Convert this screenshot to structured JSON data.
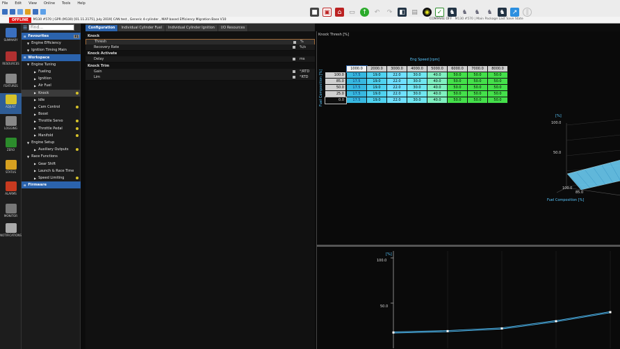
{
  "menu": [
    "File",
    "Edit",
    "View",
    "Online",
    "Tools",
    "Help"
  ],
  "status": {
    "offline_label": "OFFLINE",
    "ecu_info": "M130 #570 | GPR (M130) [01.11.2175], July 2019] CAN test , Generic 4-cylinder , MAP based Efficiency Migration Base V10",
    "compare_label": "COMPARE OFF",
    "compare_info": "M130 #570 | Main Package Last Save State"
  },
  "rail": [
    {
      "label": "SUMMARY",
      "icon": "summary-icon"
    },
    {
      "label": "RESOURCES",
      "icon": "resources-icon"
    },
    {
      "label": "FEATURES",
      "icon": "features-icon"
    },
    {
      "label": "ADJUST",
      "icon": "adjust-icon"
    },
    {
      "label": "LOGGING",
      "icon": "logging-icon"
    },
    {
      "label": "ZERO",
      "icon": "zero-icon"
    },
    {
      "label": "STATUS",
      "icon": "status-icon"
    },
    {
      "label": "ALARMS",
      "icon": "alarms-icon"
    },
    {
      "label": "MONITOR",
      "icon": "monitor-icon"
    },
    {
      "label": "NOTIFICATIONS",
      "icon": "notifications-icon"
    }
  ],
  "tree": {
    "search_placeholder": "Find...",
    "f1_badge": "F1",
    "rows": [
      {
        "label": "Favourites",
        "type": "section"
      },
      {
        "label": "Engine Efficiency",
        "indent": 1
      },
      {
        "label": "Ignition Timing Main",
        "indent": 1
      },
      {
        "label": "Workspace",
        "type": "section"
      },
      {
        "label": "Engine Tuning",
        "indent": 1
      },
      {
        "label": "Fueling",
        "indent": 2
      },
      {
        "label": "Ignition",
        "indent": 2
      },
      {
        "label": "Air Fuel",
        "indent": 2
      },
      {
        "label": "Knock",
        "indent": 2,
        "selected": true,
        "dot": true
      },
      {
        "label": "Idle",
        "indent": 2
      },
      {
        "label": "Cam Control",
        "indent": 2,
        "dot": true
      },
      {
        "label": "Boost",
        "indent": 2
      },
      {
        "label": "Throttle Servo",
        "indent": 2,
        "dot": true
      },
      {
        "label": "Throttle Pedal",
        "indent": 2,
        "dot": true
      },
      {
        "label": "Manifold",
        "indent": 2,
        "dot": true
      },
      {
        "label": "Engine Setup",
        "indent": 1
      },
      {
        "label": "Auxiliary Outputs",
        "indent": 2,
        "dot": true
      },
      {
        "label": "Race Functions",
        "indent": 1
      },
      {
        "label": "Gear Shift",
        "indent": 2
      },
      {
        "label": "Launch & Race Time",
        "indent": 2
      },
      {
        "label": "Speed Limiting",
        "indent": 2,
        "dot": true
      },
      {
        "label": "Firmware",
        "type": "section"
      }
    ]
  },
  "tabs": [
    "Configuration",
    "Individual Cylinder Fuel",
    "Individual Cylinder Ignition",
    "I/O Resources"
  ],
  "config_rows": [
    {
      "label": "Knock",
      "type": "group"
    },
    {
      "label": "Thresh",
      "unit": "%",
      "selected": true
    },
    {
      "label": "Recovery Rate",
      "unit": "%/s"
    },
    {
      "label": "Knock Activate",
      "type": "group"
    },
    {
      "label": "Delay",
      "unit": "ms"
    },
    {
      "label": "Knock Trim",
      "type": "group"
    },
    {
      "label": "Gain",
      "unit": "°/RTD"
    },
    {
      "label": "Lim",
      "unit": "°RTD"
    }
  ],
  "table": {
    "title": "Knock Thresh [%]",
    "x_axis_label": "Eng Speed [rpm]",
    "y_axis_label": "Fuel Composition [%]",
    "columns": [
      "1000.0",
      "2000.0",
      "3000.0",
      "4000.0",
      "5000.0",
      "6000.0",
      "7000.0",
      "8000.0"
    ],
    "rows": [
      {
        "label": "100.0",
        "values": [
          "17.5",
          "19.0",
          "22.0",
          "30.0",
          "40.0",
          "50.0",
          "50.0",
          "50.0"
        ]
      },
      {
        "label": "85.0",
        "values": [
          "17.5",
          "19.0",
          "22.0",
          "30.0",
          "40.0",
          "50.0",
          "50.0",
          "50.0"
        ]
      },
      {
        "label": "50.0",
        "values": [
          "17.5",
          "19.0",
          "22.0",
          "30.0",
          "40.0",
          "50.0",
          "50.0",
          "50.0"
        ]
      },
      {
        "label": "25.0",
        "values": [
          "17.5",
          "19.0",
          "22.0",
          "30.0",
          "40.0",
          "50.0",
          "50.0",
          "50.0"
        ]
      },
      {
        "label": "0.0",
        "values": [
          "17.5",
          "19.0",
          "22.0",
          "30.0",
          "40.0",
          "50.0",
          "50.0",
          "50.0"
        ]
      }
    ]
  },
  "surface3d": {
    "unit": "[%]",
    "z_ticks": [
      "100.0",
      "50.0"
    ],
    "x_ticks": [
      "100.0",
      "85.0"
    ],
    "x_label": "Fuel Composition [%]"
  },
  "chart_data": {
    "type": "line",
    "ylabel": "[%]",
    "ylim": [
      0,
      100
    ],
    "y_ticks": [
      "100.0",
      "50.0"
    ],
    "x": [
      1000,
      2000,
      3000,
      4000,
      5000
    ],
    "series": [
      {
        "values": [
          17.5,
          19.0,
          22.0,
          30.0,
          40.0
        ]
      }
    ]
  },
  "colors": {
    "accent": "#2b63ad",
    "cyan": "#59c8ff",
    "green": "#44e04a"
  }
}
